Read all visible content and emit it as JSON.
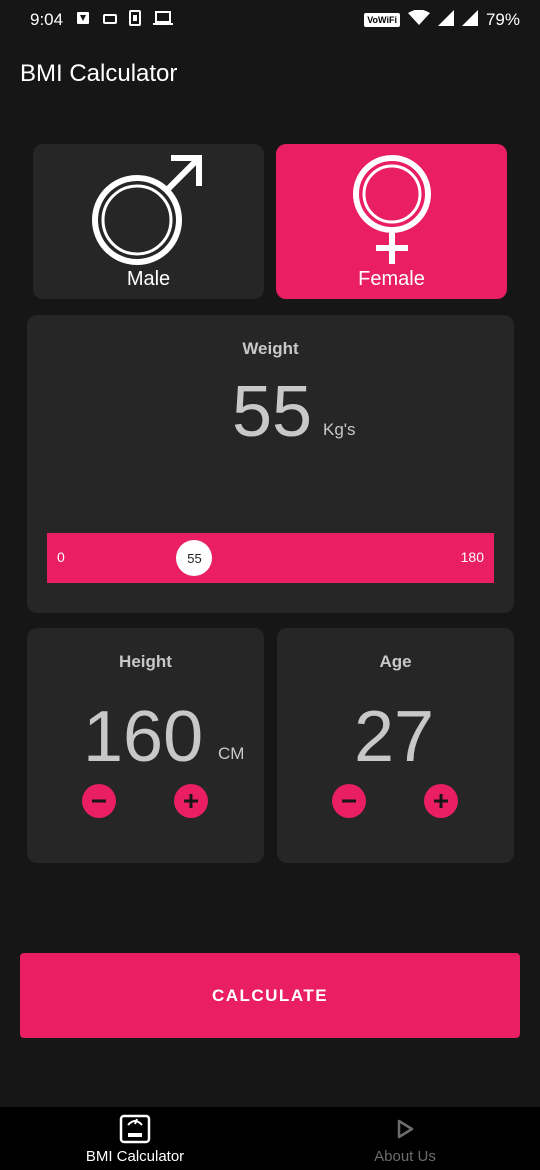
{
  "status_bar": {
    "time": "9:04",
    "wifi_label": "VoWiFi",
    "battery": "79%"
  },
  "app": {
    "title": "BMI Calculator"
  },
  "gender": {
    "male_label": "Male",
    "female_label": "Female",
    "selected": "female"
  },
  "weight": {
    "title": "Weight",
    "value": "55",
    "unit": "Kg's",
    "slider_min": "0",
    "slider_max": "180",
    "slider_value": "55",
    "slider_fraction": 0.3056
  },
  "height": {
    "title": "Height",
    "value": "160",
    "unit": "CM"
  },
  "age": {
    "title": "Age",
    "value": "27"
  },
  "calculate_label": "CALCULATE",
  "nav": {
    "items": [
      {
        "label": "BMI Calculator",
        "icon": "scale-icon",
        "active": true
      },
      {
        "label": "About Us",
        "icon": "play-icon",
        "active": false
      }
    ]
  },
  "colors": {
    "accent": "#e91e63",
    "background": "#161616",
    "card": "#262626"
  }
}
